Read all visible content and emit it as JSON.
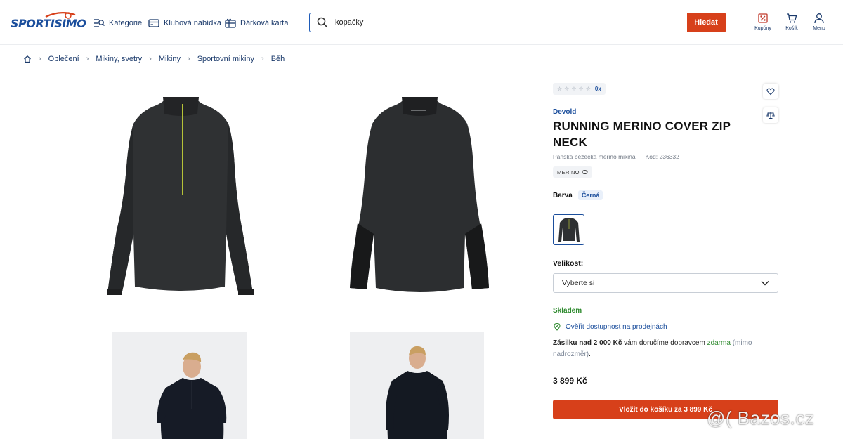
{
  "header": {
    "logo_text": "SPORTISIMO",
    "nav": {
      "kategorie": "Kategorie",
      "klubova": "Klubová nabídka",
      "darkova": "Dárková karta"
    },
    "search": {
      "value": "kopačky",
      "button": "Hledat"
    },
    "icons": {
      "kupony": "Kupóny",
      "kosik": "Košík",
      "menu": "Menu"
    }
  },
  "breadcrumb": [
    "Oblečení",
    "Mikiny, svetry",
    "Mikiny",
    "Sportovní mikiny",
    "Běh"
  ],
  "product": {
    "rating_count": "0x",
    "brand": "Devold",
    "title": "RUNNING MERINO COVER ZIP NECK",
    "subtitle": "Pánská běžecká merino mikina",
    "code": "Kód: 236332",
    "tag": "MERINO",
    "color_label": "Barva",
    "color_value": "Černá",
    "size_label": "Velikost:",
    "size_placeholder": "Vyberte si",
    "stock": "Skladem",
    "check_store": "Ověřit dostupnost na prodejnách",
    "delivery_strong": "Zásilku nad 2 000 Kč",
    "delivery_text": " vám doručíme dopravcem ",
    "delivery_free": "zdarma",
    "delivery_muted": " (mimo nadrozměr)",
    "delivery_end": ".",
    "price": "3 899 Kč",
    "cart_button": "Vložit do košíku za 3 899 Kč"
  },
  "watermark": "@( Bazos.cz",
  "colors": {
    "brand_blue": "#1b4e9c",
    "accent_orange": "#d7401a",
    "stock_green": "#2e8a2e"
  }
}
